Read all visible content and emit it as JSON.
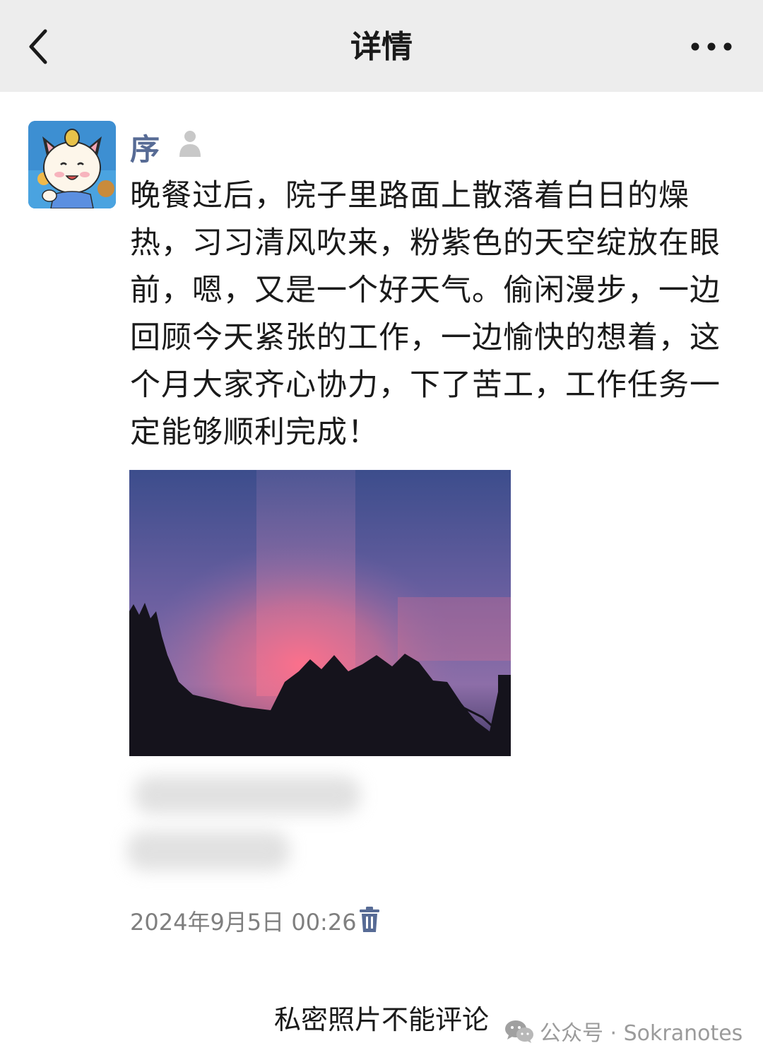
{
  "header": {
    "title": "详情",
    "back_icon": "chevron-left-icon",
    "more_icon": "more-dots-icon"
  },
  "post": {
    "author": "序",
    "text": "晚餐过后，院子里路面上散落着白日的燥热，习习清风吹来，粉紫色的天空绽放在眼前，嗯，又是一个好天气。偷闲漫步，一边回顾今天紧张的工作，一边愉快的想着，这个月大家齐心协力，下了苦工，工作任务一定能够顺利完成！",
    "timestamp": "2024年9月5日 00:26",
    "privacy_icon": "person-private-icon",
    "delete_icon": "trash-icon"
  },
  "footer": {
    "note": "私密照片不能评论"
  },
  "watermark": {
    "text": "公众号 · Sokranotes",
    "icon": "wechat-icon"
  },
  "colors": {
    "nav_bg": "#ededed",
    "username": "#576b95",
    "timestamp": "#7f7f7f",
    "delete_icon": "#576b95",
    "watermark": "#9b9b9b"
  }
}
